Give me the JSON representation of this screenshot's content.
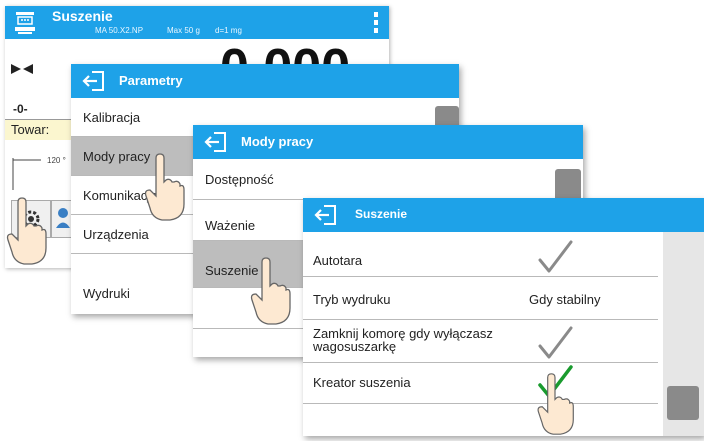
{
  "main_screen": {
    "title": "Suszenie",
    "model": "MA 50.X2.NP",
    "max": "Max 50 g",
    "d": "d=1 mg",
    "value": "0,000",
    "zero_indicator": "-0-",
    "product_label": "Towar:",
    "graph_label": "120 °"
  },
  "parametry": {
    "title": "Parametry",
    "items": [
      "Kalibracja",
      "Mody pracy",
      "Komunikacja",
      "Urządzenia",
      "Wydruki"
    ]
  },
  "mody_pracy": {
    "title": "Mody pracy",
    "items": [
      "Dostępność",
      "Ważenie",
      "Suszenie"
    ]
  },
  "suszenie": {
    "title": "Suszenie",
    "rows": [
      {
        "label": "Autotara",
        "value": ""
      },
      {
        "label": "Tryb wydruku",
        "value": "Gdy stabilny"
      },
      {
        "label": "Zamknij komorę gdy wyłączasz wagosuszarkę",
        "value": ""
      },
      {
        "label": "Kreator suszenia",
        "value": ""
      }
    ]
  },
  "colors": {
    "header_blue": "#1ea2e8",
    "selected_gray": "#bdbdbd",
    "check_gray": "#8a8a8a",
    "check_green": "#1a9b2e"
  },
  "icons": [
    "balance-icon",
    "menu-dots-icon",
    "back-arrow-icon",
    "hand-pointer-icon",
    "checkmark-icon",
    "gear-icon",
    "user-icon",
    "stability-icon"
  ]
}
